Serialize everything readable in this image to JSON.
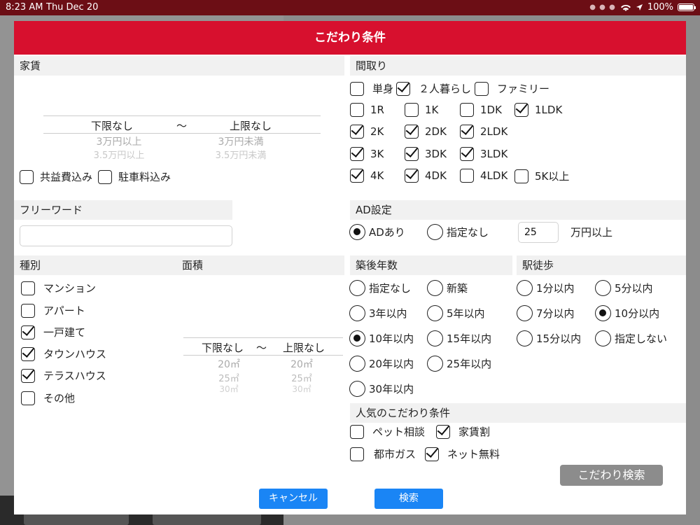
{
  "status": {
    "time": "8:23 AM",
    "date": "Thu Dec 20",
    "battery": "100%"
  },
  "modal": {
    "title": "こだわり条件"
  },
  "rent": {
    "section": "家賃",
    "picker_selected_min": "下限なし",
    "picker_tilde": "〜",
    "picker_selected_max": "上限なし",
    "min_options": [
      "3万円以上",
      "3.5万円以上"
    ],
    "max_options": [
      "3万円未満",
      "3.5万円未満"
    ],
    "include_common_fee": {
      "label": "共益費込み",
      "checked": false
    },
    "include_parking": {
      "label": "駐車料込み",
      "checked": false
    }
  },
  "free_word": {
    "section": "フリーワード",
    "value": ""
  },
  "type": {
    "section": "種別",
    "items": [
      {
        "label": "マンション",
        "checked": false
      },
      {
        "label": "アパート",
        "checked": false
      },
      {
        "label": "一戸建て",
        "checked": true
      },
      {
        "label": "タウンハウス",
        "checked": true
      },
      {
        "label": "テラスハウス",
        "checked": true
      },
      {
        "label": "その他",
        "checked": false
      }
    ]
  },
  "area": {
    "section": "面積",
    "picker_selected_min": "下限なし",
    "picker_tilde": "〜",
    "picker_selected_max": "上限なし",
    "min_options": [
      "20㎡",
      "25㎡",
      "30㎡"
    ],
    "max_options": [
      "20㎡",
      "25㎡",
      "30㎡"
    ]
  },
  "layout": {
    "section": "間取り",
    "row0": [
      {
        "label": "単身",
        "checked": false
      },
      {
        "label": "２人暮らし",
        "checked": true
      },
      {
        "label": "ファミリー",
        "checked": false
      }
    ],
    "grid": [
      [
        {
          "label": "1R",
          "checked": false
        },
        {
          "label": "1K",
          "checked": false
        },
        {
          "label": "1DK",
          "checked": false
        },
        {
          "label": "1LDK",
          "checked": true
        }
      ],
      [
        {
          "label": "2K",
          "checked": true
        },
        {
          "label": "2DK",
          "checked": true
        },
        {
          "label": "2LDK",
          "checked": true
        }
      ],
      [
        {
          "label": "3K",
          "checked": true
        },
        {
          "label": "3DK",
          "checked": true
        },
        {
          "label": "3LDK",
          "checked": true
        }
      ],
      [
        {
          "label": "4K",
          "checked": true
        },
        {
          "label": "4DK",
          "checked": true
        },
        {
          "label": "4LDK",
          "checked": false
        },
        {
          "label": "5K以上",
          "checked": false
        }
      ]
    ]
  },
  "ad": {
    "section": "AD設定",
    "options": [
      {
        "label": "ADあり",
        "checked": true
      },
      {
        "label": "指定なし",
        "checked": false
      }
    ],
    "amount": "25",
    "unit": "万円以上"
  },
  "age": {
    "section": "築後年数",
    "options": [
      {
        "label": "指定なし",
        "checked": false
      },
      {
        "label": "新築",
        "checked": false
      },
      {
        "label": "3年以内",
        "checked": false
      },
      {
        "label": "5年以内",
        "checked": false
      },
      {
        "label": "10年以内",
        "checked": true
      },
      {
        "label": "15年以内",
        "checked": false
      },
      {
        "label": "20年以内",
        "checked": false
      },
      {
        "label": "25年以内",
        "checked": false
      },
      {
        "label": "30年以内",
        "checked": false
      }
    ]
  },
  "walk": {
    "section": "駅徒歩",
    "options": [
      {
        "label": "1分以内",
        "checked": false
      },
      {
        "label": "5分以内",
        "checked": false
      },
      {
        "label": "7分以内",
        "checked": false
      },
      {
        "label": "10分以内",
        "checked": true
      },
      {
        "label": "15分以内",
        "checked": false
      },
      {
        "label": "指定しない",
        "checked": false
      }
    ]
  },
  "popular": {
    "section": "人気のこだわり条件",
    "items": [
      {
        "label": "ペット相談",
        "checked": false
      },
      {
        "label": "家賃割",
        "checked": true
      },
      {
        "label": "都市ガス",
        "checked": false
      },
      {
        "label": "ネット無料",
        "checked": true
      }
    ],
    "search_button": "こだわり検索"
  },
  "footer": {
    "cancel": "キャンセル",
    "search": "検索"
  }
}
